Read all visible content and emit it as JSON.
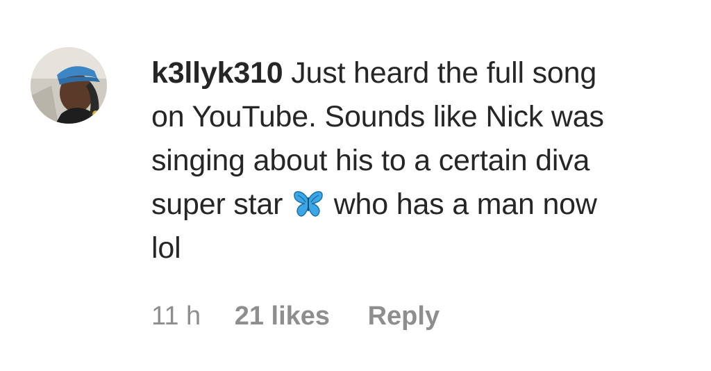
{
  "comment": {
    "username": "k3llyk310",
    "text_lines": [
      "Just heard the full song",
      "on YouTube. Sounds like Nick was",
      "singing about his to a certain diva",
      "super star",
      "who has a man now",
      "lol"
    ],
    "emoji_icon": "butterfly-icon",
    "timestamp": "11 h",
    "likes": "21 likes",
    "reply_label": "Reply"
  },
  "colors": {
    "text": "#262626",
    "meta": "#8e8e8e",
    "butterfly": "#3aa8e6"
  }
}
